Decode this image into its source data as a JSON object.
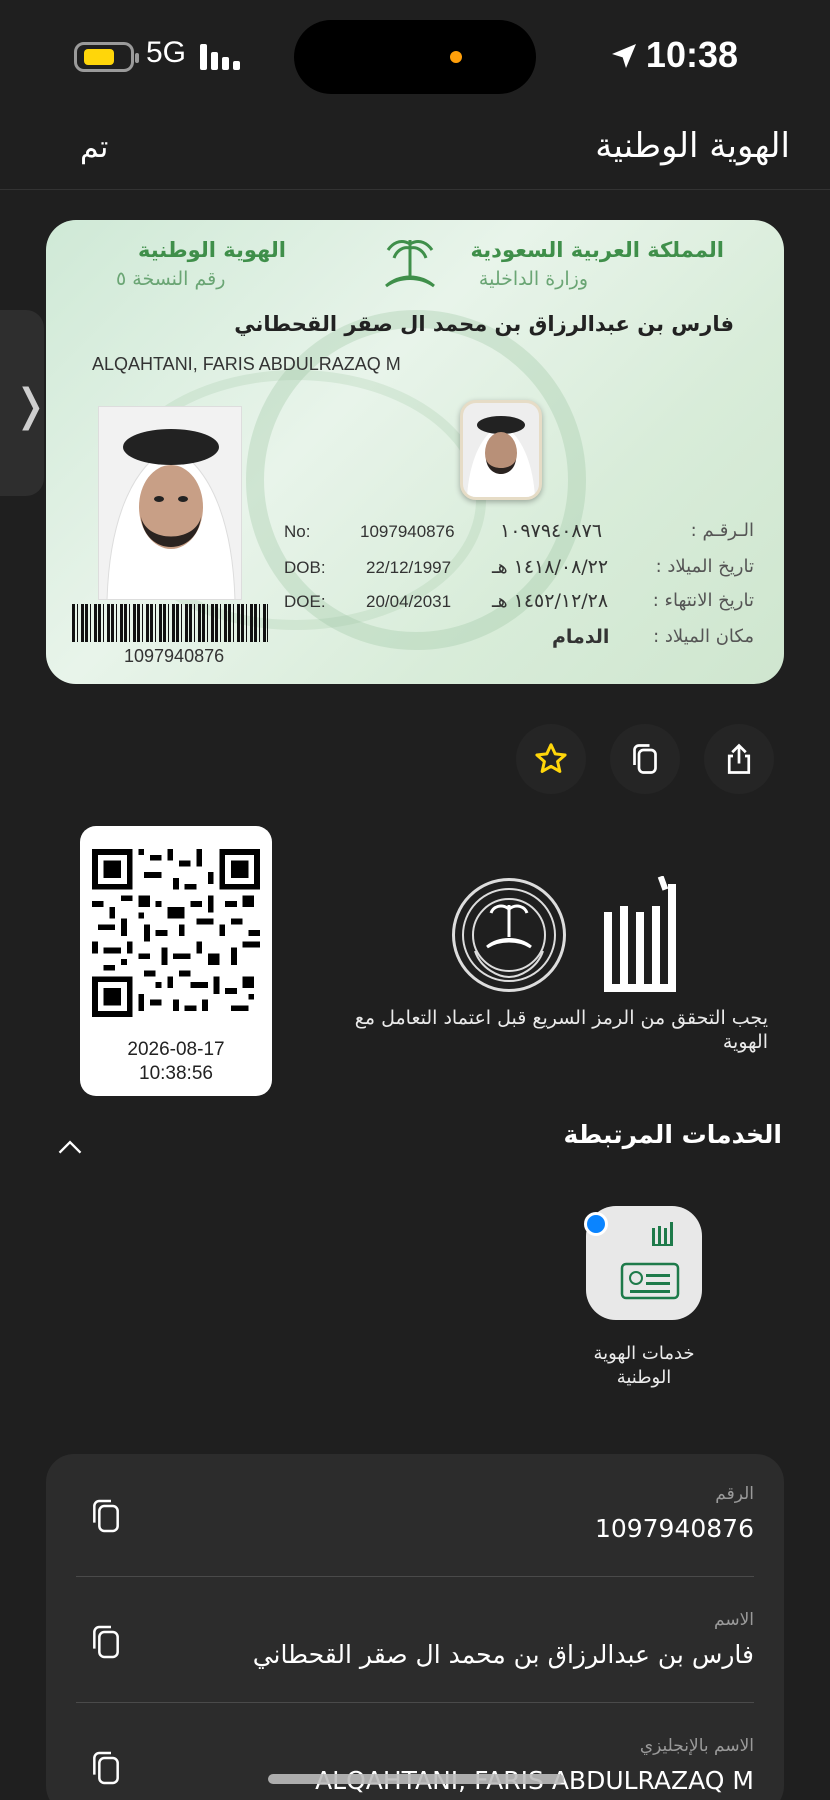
{
  "status_bar": {
    "network": "5G",
    "time": "10:38"
  },
  "header": {
    "title": "الهوية الوطنية",
    "done_label": "تم"
  },
  "card": {
    "kingdom": "المملكة العربية السعودية",
    "ministry": "وزارة الداخلية",
    "id_label": "الهوية الوطنية",
    "version_label": "رقم النسخة ٥",
    "name_ar": "فارس بن عبدالرزاق بن محمد ال صقر القحطاني",
    "name_en": "ALQAHTANI, FARIS ABDULRAZAQ M",
    "no_label_en": "No:",
    "no_value": "1097940876",
    "no_value_ar": "١٠٩٧٩٤٠٨٧٦",
    "no_label_ar": "الـرقـم :",
    "dob_label_en": "DOB:",
    "dob_value": "22/12/1997",
    "dob_value_ar": "١٤١٨/٠٨/٢٢ هـ",
    "dob_label_ar": "تاريخ الميلاد :",
    "doe_label_en": "DOE:",
    "doe_value": "20/04/2031",
    "doe_value_ar": "١٤٥٢/١٢/٢٨ هـ",
    "doe_label_ar": "تاريخ الانتهاء :",
    "pob_label_ar": "مكان الميلاد :",
    "pob_value_ar": "الدمام",
    "barcode_number": "1097940876"
  },
  "actions": [
    "star-icon",
    "copy-icon",
    "share-icon"
  ],
  "qr": {
    "date": "2026-08-17",
    "time": "10:38:56"
  },
  "verify_text": "يجب التحقق من الرمز السريع قبل اعتماد التعامل مع الهوية",
  "services": {
    "title": "الخدمات المرتبطة",
    "items": [
      {
        "label": "خدمات الهوية الوطنية"
      }
    ]
  },
  "info_rows": [
    {
      "label": "الرقم",
      "value": "1097940876"
    },
    {
      "label": "الاسم",
      "value": "فارس بن عبدالرزاق بن محمد ال صقر القحطاني"
    },
    {
      "label": "الاسم بالإنجليزي",
      "value": "ALQAHTANI, FARIS ABDULRAZAQ M"
    }
  ],
  "colors": {
    "background": "#1f1f1f",
    "accent_star": "#ffd60a",
    "card_green": "#3f8f4a",
    "notification_dot": "#0a84ff"
  }
}
